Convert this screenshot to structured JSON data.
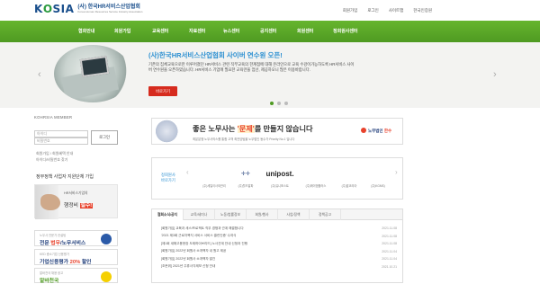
{
  "header": {
    "logo_mark": "K",
    "logo_mark_rest": "SIA",
    "org_name_ko": "(사) 한국HR서비스산업협회",
    "org_name_en": "Korea Human Resources Service Industry Association",
    "util_links": [
      "회원가입",
      "로그인",
      "사이트맵",
      "한국인증원"
    ]
  },
  "gnb": {
    "items": [
      "협회안내",
      "회원가입",
      "교육센터",
      "자료센터",
      "뉴스센터",
      "공지센터",
      "회원센터",
      "정회원사센터"
    ]
  },
  "hero": {
    "title": "(사)한국HR서비스산업협회 사이버 연수원 오픈!",
    "desc": "기존의 집체교육으로만 이루어졌던 HR서비스 관련 직무교육의 한계점에 대해 온라인으로 교육 수강이가능하도록 HR서비스 사이버 연수원을 오픈하였습니다. HR서비스 기업에 필요한 교육만을 엄선, 제공하오니 많은 이용바랍니다.",
    "button": "바로가기",
    "prev_icon": "‹",
    "next_icon": "›"
  },
  "member": {
    "title": "KOHRSIA MEMBER",
    "id_placeholder": "아이디",
    "pw_placeholder": "비밀번호",
    "login_button": "로그인",
    "find_links": [
      "회원가입 / 회원혜택 안내",
      "아이디/비밀번호 찾기"
    ]
  },
  "left_promo": {
    "section_title": "정부정책 사업자 지원단체 가입",
    "promo_small": "HR서비스기업의",
    "promo_big_pre": "행정비",
    "promo_big_mark": "필수!",
    "ads": [
      {
        "small": "노무사 전문가 컨설팅",
        "big_pre": "전문 ",
        "big_mark": "법무",
        "big_post": "/노무서비스"
      },
      {
        "small": "KED 중소기업 신용평가",
        "big_pre": "기업신용평가 ",
        "big_mark": "20%",
        "big_post": " 할인"
      },
      {
        "small": "알바천국 채용 광고",
        "big_pre": "알바천국",
        "big_mark": "",
        "big_post": ""
      }
    ]
  },
  "banner": {
    "main_pre": "좋은 노무사는 ",
    "main_mark": "'문제'",
    "main_post": "를 만들지 않습니다",
    "sub": "최분분쟁 노무사의스를 통합 고객 최전담팀을 노무법인 동수가 Priority No.1 입니다",
    "brand_pre": "노무법인 ",
    "brand_mark": "한수"
  },
  "partners": {
    "label_line1": "정회원사",
    "label_line2": "바로가기",
    "items": [
      {
        "logo": "",
        "name": "(주)세일이사외관리"
      },
      {
        "logo": "✛✛",
        "name": "(주)월드알파"
      },
      {
        "logo": "unipost.",
        "name": "(주)유니포스트"
      },
      {
        "logo": "",
        "name": "(주)에이엠플러스"
      },
      {
        "logo": "",
        "name": "(주)잡코리아"
      },
      {
        "logo": "",
        "name": "(주)KGMS)"
      }
    ],
    "prev_icon": "‹",
    "next_icon": "›"
  },
  "notice": {
    "tabs": [
      "협회소식/공지",
      "교육/세미나",
      "노동/법률정보",
      "회원/행사",
      "사업/정책",
      "정책공고"
    ],
    "rows": [
      {
        "title": "[회원가입] 교육과 세스/프로젝트 직무 경쟁과 관계 해결합니다",
        "date": "2021.11.08"
      },
      {
        "title": "'2021 제3회 근로자복지 서비스 서비스 클린인증' 수여식",
        "date": "2021.11.08"
      },
      {
        "title": "[제1회 새해고용현장 도제하이브리드] 노사관계 안내 신청과 진행",
        "date": "2021.11.08"
      },
      {
        "title": "[회원가입] 2022년 회원사 소개책자 내 원고 제공",
        "date": "2021.11.04"
      },
      {
        "title": "[회원가입] 2022년 회원사 소개책자 발간",
        "date": "2021.11.04"
      },
      {
        "title": "[조문위] 2021년 주휴사각제보 신청 안내",
        "date": "2021.10.21"
      }
    ]
  },
  "colors": {
    "gnb_green": "#5aa829",
    "accent_blue": "#2b8fd1",
    "accent_red": "#d62b1e"
  }
}
